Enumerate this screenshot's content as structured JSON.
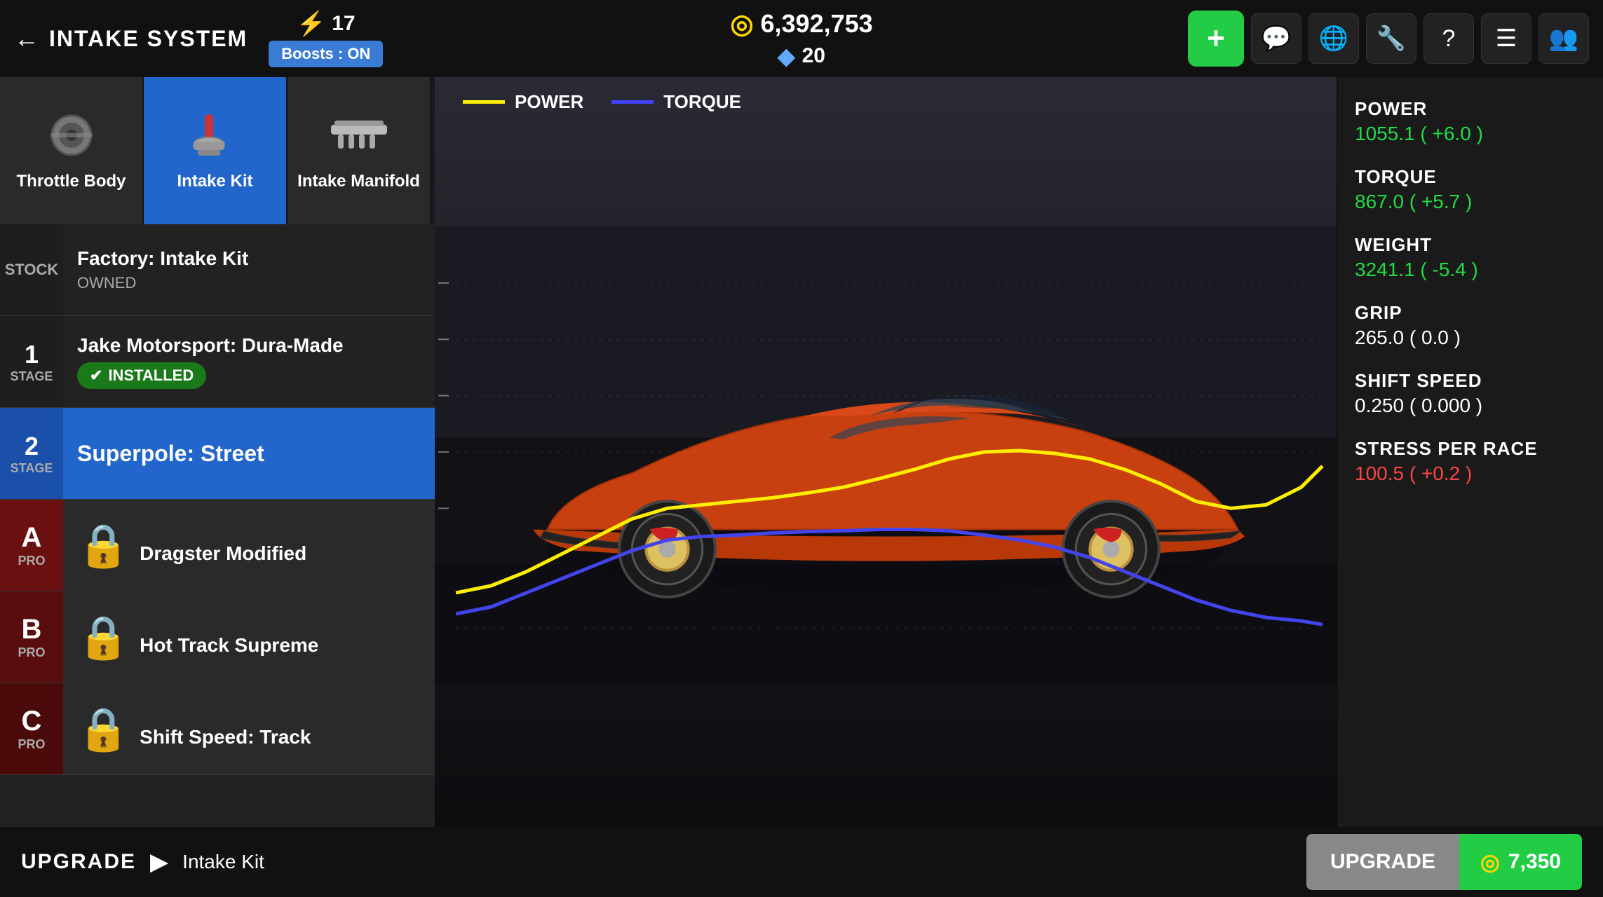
{
  "header": {
    "back_label": "INTAKE SYSTEM",
    "bolt_count": "17",
    "boosts_label": "Boosts : ON",
    "coins": "6,392,753",
    "diamonds": "20",
    "add_icon": "+",
    "nav_icons": [
      "💬",
      "🌐",
      "🔧",
      "?",
      "≡≡",
      "👥"
    ]
  },
  "tabs": [
    {
      "id": "throttle-body",
      "label": "Throttle Body",
      "active": false
    },
    {
      "id": "intake-kit",
      "label": "Intake Kit",
      "active": true
    },
    {
      "id": "intake-manifold",
      "label": "Intake Manifold",
      "active": false
    }
  ],
  "upgrades": [
    {
      "id": "stock",
      "stage_type": "stock",
      "stage_display": "STOCK",
      "name": "Factory: Intake Kit",
      "sub": "OWNED",
      "installed": false,
      "locked": false,
      "selected": false
    },
    {
      "id": "stage1",
      "stage_type": "stage",
      "stage_number": "1",
      "stage_label": "STAGE",
      "name": "Jake Motorsport: Dura-Made",
      "sub": "",
      "installed": true,
      "locked": false,
      "selected": false
    },
    {
      "id": "stage2",
      "stage_type": "stage",
      "stage_number": "2",
      "stage_label": "STAGE",
      "name": "Superpole: Street",
      "sub": "",
      "installed": false,
      "locked": false,
      "selected": true
    },
    {
      "id": "stageA",
      "stage_type": "pro",
      "stage_letter": "A",
      "stage_label": "PRO",
      "name": "Dragster Modified",
      "sub": "",
      "installed": false,
      "locked": true,
      "selected": false
    },
    {
      "id": "stageB",
      "stage_type": "pro",
      "stage_letter": "B",
      "stage_label": "PRO",
      "name": "Hot Track Supreme",
      "sub": "",
      "installed": false,
      "locked": true,
      "selected": false
    },
    {
      "id": "stageC",
      "stage_type": "pro",
      "stage_letter": "C",
      "stage_label": "PRO",
      "name": "Shift Speed: Track",
      "sub": "",
      "installed": false,
      "locked": true,
      "selected": false
    }
  ],
  "chart": {
    "power_label": "POWER",
    "torque_label": "TORQUE"
  },
  "stats": {
    "power_label": "POWER",
    "power_value": "1055.1 ( +6.0 )",
    "torque_label": "TORQUE",
    "torque_value": "867.0 ( +5.7 )",
    "weight_label": "WEIGHT",
    "weight_value": "3241.1 ( -5.4 )",
    "grip_label": "GRIP",
    "grip_value": "265.0 ( 0.0 )",
    "shift_speed_label": "SHIFT SPEED",
    "shift_speed_value": "0.250 ( 0.000 )",
    "stress_label": "STRESS PER RACE",
    "stress_value": "100.5 ( +0.2 )"
  },
  "bottom": {
    "upgrade_label": "UPGRADE",
    "upgrade_part": "Intake Kit",
    "upgrade_btn_label": "UPGRADE",
    "cost": "7,350",
    "installed_label": "INSTALLED"
  }
}
